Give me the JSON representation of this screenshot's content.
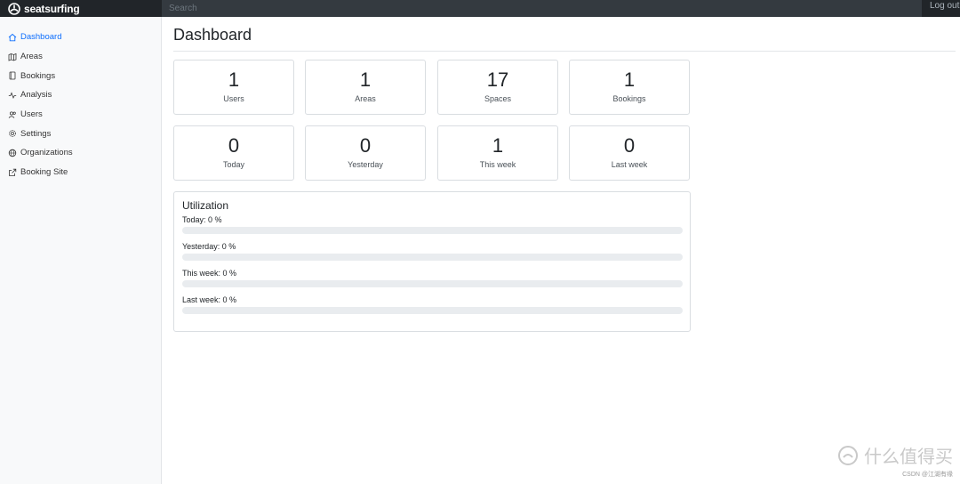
{
  "app": {
    "brand": "seatsurfing"
  },
  "topbar": {
    "search_placeholder": "Search",
    "logout_label": "Log out"
  },
  "sidebar": {
    "items": [
      {
        "label": "Dashboard",
        "icon": "home-icon",
        "active": true
      },
      {
        "label": "Areas",
        "icon": "map-icon"
      },
      {
        "label": "Bookings",
        "icon": "book-icon"
      },
      {
        "label": "Analysis",
        "icon": "activity-icon"
      },
      {
        "label": "Users",
        "icon": "users-icon"
      },
      {
        "label": "Settings",
        "icon": "gear-icon"
      },
      {
        "label": "Organizations",
        "icon": "globe-icon"
      },
      {
        "label": "Booking Site",
        "icon": "external-link-icon"
      }
    ]
  },
  "main": {
    "title": "Dashboard",
    "stats": [
      {
        "value": "1",
        "label": "Users"
      },
      {
        "value": "1",
        "label": "Areas"
      },
      {
        "value": "17",
        "label": "Spaces"
      },
      {
        "value": "1",
        "label": "Bookings"
      },
      {
        "value": "0",
        "label": "Today"
      },
      {
        "value": "0",
        "label": "Yesterday"
      },
      {
        "value": "1",
        "label": "This week"
      },
      {
        "value": "0",
        "label": "Last week"
      }
    ],
    "utilization": {
      "title": "Utilization",
      "rows": [
        {
          "label": "Today: 0 %",
          "percent": 0
        },
        {
          "label": "Yesterday: 0 %",
          "percent": 0
        },
        {
          "label": "This week: 0 %",
          "percent": 0
        },
        {
          "label": "Last week: 0 %",
          "percent": 0
        }
      ]
    }
  },
  "watermark": {
    "logo_text": "什么值得买",
    "credit": "CSDN @江湖有缘"
  },
  "colors": {
    "active": "#0d6efd",
    "topbar": "#343a40",
    "brand_bg": "#212529",
    "sidebar_bg": "#f8f9fa",
    "progress_track": "#e9ecef"
  }
}
